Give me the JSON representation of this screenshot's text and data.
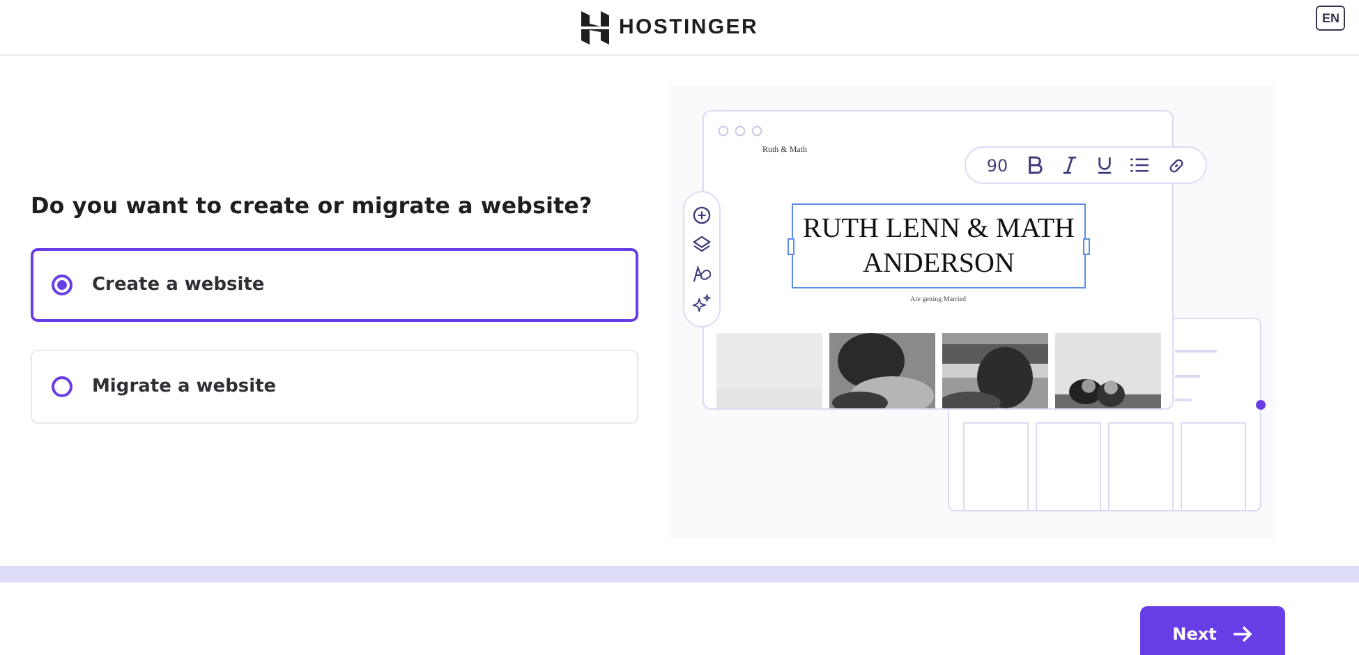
{
  "header": {
    "brand": "HOSTINGER",
    "language": "EN"
  },
  "question": "Do you want to create or migrate a website?",
  "options": [
    {
      "label": "Create a website",
      "selected": true
    },
    {
      "label": "Migrate a website",
      "selected": false
    }
  ],
  "illustration": {
    "site_name": "Ruth & Math",
    "font_size": "90",
    "headline": "RUTH LENN & MATH ANDERSON",
    "tagline": "Are getting Married"
  },
  "footer": {
    "next_button": "Next"
  }
}
